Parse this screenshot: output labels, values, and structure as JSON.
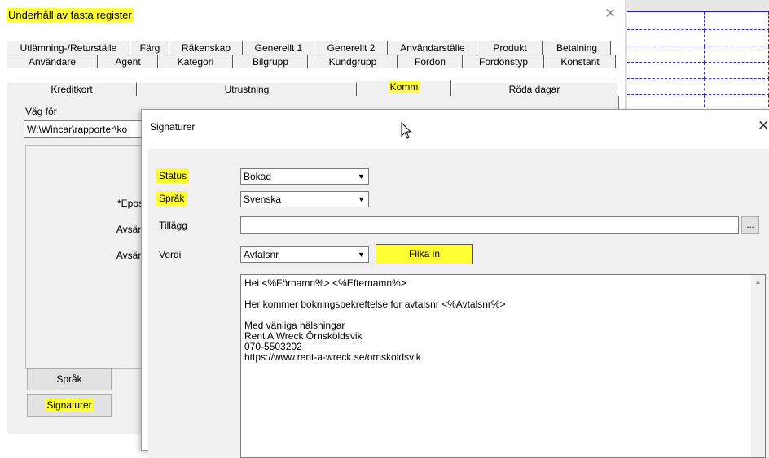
{
  "main_window": {
    "title": "Underhåll av fasta register",
    "close_label": "✕",
    "tabs_row1": [
      "Utlämning-/Returställe",
      "Färg",
      "Räkenskap",
      "Generellt 1",
      "Generellt 2",
      "Användarställe",
      "Produkt",
      "Betalning"
    ],
    "tabs_row2": [
      "Användare",
      "Agent",
      "Kategori",
      "Bilgrupp",
      "Kundgrupp",
      "Fordon",
      "Fordonstyp",
      "Konstant"
    ],
    "tabs_row3": [
      "Kreditkort",
      "Utrustning",
      "Komm",
      "Röda dagar"
    ],
    "active_tab": "Komm",
    "path_label": "Väg för",
    "path_value": "W:\\Wincar\\rapporter\\ko",
    "group_labels": [
      "*Epos",
      "Avsän",
      "Avsän"
    ],
    "buttons": {
      "sprak": "Språk",
      "signaturer": "Signaturer"
    }
  },
  "dialog": {
    "title": "Signaturer",
    "close_label": "✕",
    "fields": {
      "status": {
        "label": "Status",
        "value": "Bokad"
      },
      "sprak": {
        "label": "Språk",
        "value": "Svenska"
      },
      "tillagg": {
        "label": "Tillägg",
        "value": "",
        "browse_label": "..."
      },
      "verdi": {
        "label": "Verdi",
        "value": "Avtalsnr",
        "insert_button": "Flika in"
      }
    },
    "signature_lines": [
      "Hei <%Förnamn%> <%Efternamn%>",
      "",
      "Her kommer bokningsbekreftelse for avtalsnr <%Avtalsnr%>",
      "",
      "Med vänliga hälsningar",
      "Rent A Wreck Örnsköldsvik",
      "070-5503202",
      "https://www.rent-a-wreck.se/ornskoldsvik"
    ]
  },
  "colors": {
    "highlight": "#ffff33",
    "grid_dash": "#3030c0"
  }
}
